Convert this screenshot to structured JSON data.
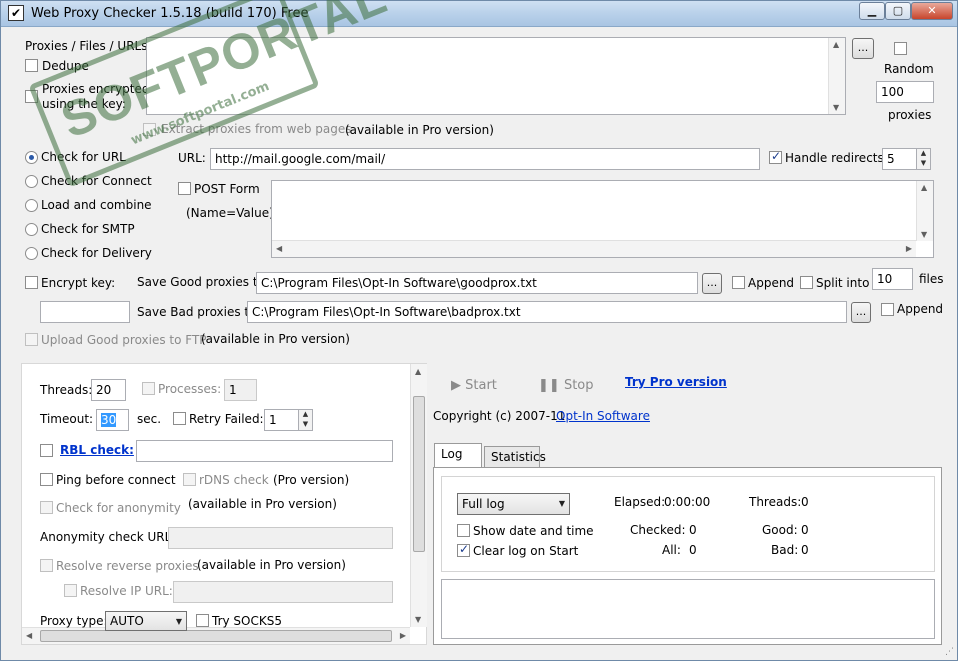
{
  "window": {
    "title": "Web Proxy Checker 1.5.18 (build 170) Free",
    "icon": "check-icon"
  },
  "top": {
    "proxies_label": "Proxies / Files / URLs:",
    "dedupe_label": "Dedupe",
    "encrypted_label_1": "Proxies encrypted",
    "encrypted_label_2": "using the key:",
    "browse_label": "...",
    "random_label": "Random",
    "random_count": "100",
    "proxies_label2": "proxies",
    "extract_label": "Extract proxies from web pages",
    "extract_note": "(available in Pro version)"
  },
  "modes": [
    {
      "label": "Check for URL",
      "checked": true
    },
    {
      "label": "Check for Connect",
      "checked": false
    },
    {
      "label": "Load and combine",
      "checked": false
    },
    {
      "label": "Check for SMTP",
      "checked": false
    },
    {
      "label": "Check for Delivery",
      "checked": false
    }
  ],
  "url": {
    "label": "URL:",
    "value": "http://mail.google.com/mail/",
    "handle_redirects_label": "Handle redirects",
    "handle_redirects_checked": true,
    "redirects_count": "5",
    "post_form_label": "POST Form",
    "post_form_hint": "(Name=Value)"
  },
  "save": {
    "encrypt_key_label": "Encrypt key:",
    "good_label": "Save Good proxies to:",
    "good_path": "C:\\Program Files\\Opt-In Software\\goodprox.txt",
    "append_label": "Append",
    "split_label": "Split into",
    "split_count": "10",
    "files_label": "files",
    "bad_label": "Save Bad proxies to:",
    "bad_path": "C:\\Program Files\\Opt-In Software\\badprox.txt",
    "browse_label": "...",
    "upload_label": "Upload Good proxies to FTP",
    "upload_note": "(available in Pro version)"
  },
  "settings": {
    "threads_label": "Threads:",
    "threads_value": "20",
    "processes_label": "Processes:",
    "processes_value": "1",
    "timeout_label": "Timeout:",
    "timeout_value": "30",
    "sec_label": "sec.",
    "retry_label": "Retry Failed:",
    "retry_value": "1",
    "rbl_label": "RBL check:",
    "ping_label": "Ping before connect",
    "rdns_label": "rDNS check",
    "rdns_note": "(Pro version)",
    "anon_label": "Check for anonymity",
    "anon_note": "(available in Pro version)",
    "anon_url_label": "Anonymity check URL:",
    "resolve_label": "Resolve reverse proxies",
    "resolve_note": "(available in Pro version)",
    "resolve_ip_label": "Resolve IP URL:",
    "proxy_type_label": "Proxy type:",
    "proxy_type_value": "AUTO",
    "socks5_label": "Try SOCKS5"
  },
  "actions": {
    "start_label": "Start",
    "stop_label": "Stop",
    "pro_link": "Try Pro version",
    "copyright": "Copyright (c) 2007-11",
    "company_link": "Opt-In Software"
  },
  "tabs": [
    {
      "label": "Log",
      "active": true
    },
    {
      "label": "Statistics",
      "active": false
    }
  ],
  "log": {
    "level": "Full log",
    "show_date_label": "Show date and time",
    "show_date_checked": false,
    "clear_label": "Clear log on Start",
    "clear_checked": true,
    "elapsed_label": "Elapsed:",
    "elapsed_value": "0:00:00",
    "threads_label": "Threads:",
    "threads_value": "0",
    "checked_label": "Checked:",
    "checked_value": "0",
    "good_label": "Good:",
    "good_value": "0",
    "all_label": "All:",
    "all_value": "0",
    "bad_label": "Bad:",
    "bad_value": "0"
  },
  "watermark": {
    "text": "SOFTPORTAL",
    "url": "www.softportal.com"
  },
  "colors": {
    "link": "#0033cc",
    "title_bar": "#b9d1ea",
    "watermark": "#3c6e3c"
  }
}
